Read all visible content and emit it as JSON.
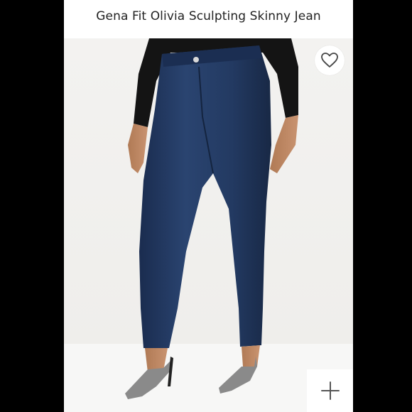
{
  "listing": {
    "title": "Gena Fit Olivia Sculpting Skinny Jean"
  },
  "icons": {
    "favorite": "heart-outline-icon",
    "add": "plus-icon"
  },
  "colors": {
    "denim": "#1f3358",
    "top": "#141414",
    "background": "#f1f0ee"
  }
}
